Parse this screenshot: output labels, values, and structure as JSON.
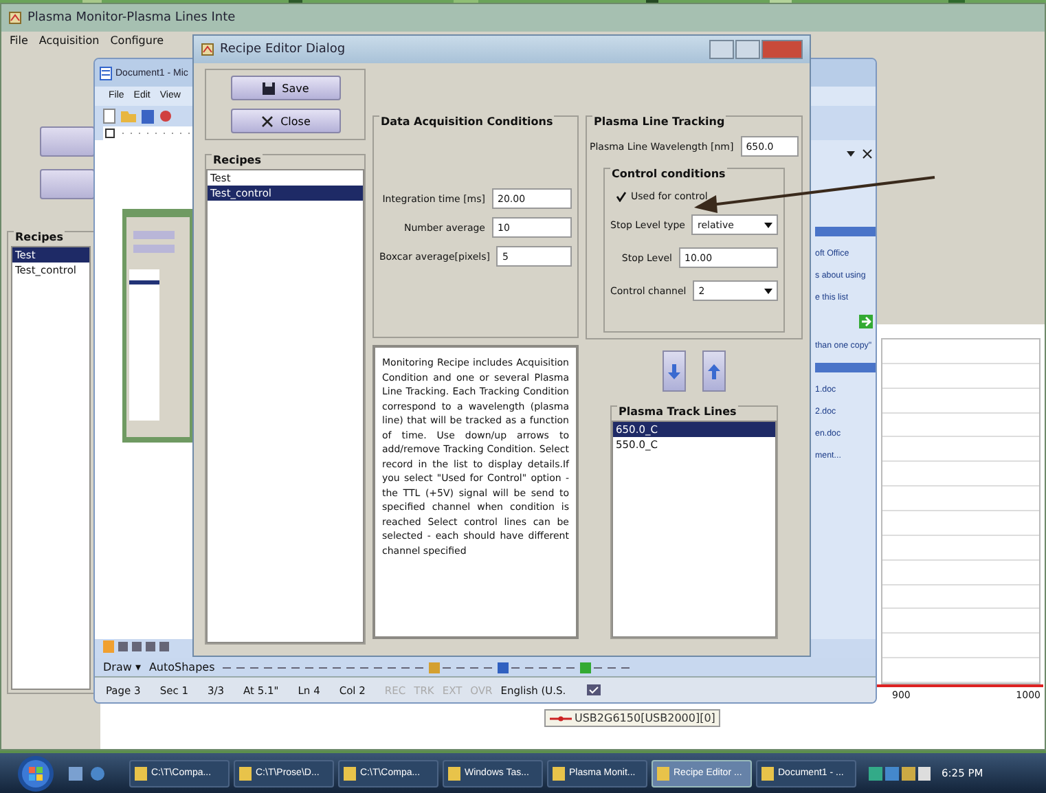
{
  "main_window": {
    "title": "Plasma Monitor-Plasma Lines Inte",
    "menu": [
      "File",
      "Acquisition",
      "Configure"
    ],
    "recipes": {
      "title": "Recipes",
      "items": [
        {
          "label": "Test",
          "selected": true
        },
        {
          "label": "Test_control",
          "selected": false
        }
      ]
    },
    "chart": {
      "tick_labels": [
        "900",
        "1000"
      ],
      "legend": "USB2G6150[USB2000][0]"
    }
  },
  "word_window": {
    "title": "Document1 - Mic",
    "menu": [
      "File",
      "Edit",
      "View"
    ],
    "task_pane_texts": [
      "oft Office",
      "s about using",
      "e this list",
      "than one copy\"",
      "1.doc",
      "2.doc",
      "en.doc",
      "ment..."
    ],
    "draw_toolbar": [
      "Draw ▾",
      "AutoShapes"
    ],
    "status_bar": [
      "Page 3",
      "Sec 1",
      "3/3",
      "At 5.1\"",
      "Ln 4",
      "Col 2"
    ],
    "status_indicators": [
      {
        "label": "REC",
        "on": false
      },
      {
        "label": "TRK",
        "on": false
      },
      {
        "label": "EXT",
        "on": false
      },
      {
        "label": "OVR",
        "on": false
      }
    ],
    "language": "English (U.S."
  },
  "dialog": {
    "title": "Recipe Editor Dialog",
    "buttons": [
      {
        "kind": "save",
        "label": "Save"
      },
      {
        "kind": "close",
        "label": "Close"
      }
    ],
    "recipes": {
      "title": "Recipes",
      "items": [
        {
          "label": "Test",
          "selected": false
        },
        {
          "label": "Test_control",
          "selected": true
        }
      ]
    },
    "acquisition": {
      "title": "Data Acquisition Conditions",
      "fields": [
        {
          "label": "Integration time [ms]",
          "value": "20.00"
        },
        {
          "label": "Number average",
          "value": "10"
        },
        {
          "label": "Boxcar average[pixels]",
          "value": "5"
        }
      ]
    },
    "description": "Monitoring Recipe includes Acquisition Condition and one or several Plasma Line Tracking. Each Tracking Condition correspond to a wavelength (plasma line) that will be tracked as a function of time. Use down/up arrows to add/remove Tracking Condition. Select record in the list to display details.If you select \"Used for Control\" option - the TTL (+5V) signal will be send to specified channel when condition is reached Select control lines can be selected - each should have different channel specified",
    "tracking": {
      "title": "Plasma Line Tracking",
      "wavelength": {
        "label": "Plasma Line Wavelength [nm]",
        "value": "650.0"
      },
      "control": {
        "title": "Control conditions",
        "used_for_control": {
          "label": "Used for control",
          "checked": true
        },
        "rows": [
          {
            "kind": "dropdown",
            "label": "Stop Level type",
            "value": "relative"
          },
          {
            "kind": "field",
            "label": "Stop Level",
            "value": "10.00"
          },
          {
            "kind": "dropdown",
            "label": "Control channel",
            "value": "2"
          }
        ]
      }
    },
    "track_lines": {
      "title": "Plasma Track Lines",
      "items": [
        {
          "label": "650.0_C",
          "selected": true
        },
        {
          "label": "550.0_C",
          "selected": false
        }
      ]
    }
  },
  "taskbar": {
    "tasks": [
      {
        "label": "C:\\T\\Compa...",
        "selected": false
      },
      {
        "label": "C:\\T\\Prose\\D...",
        "selected": false
      },
      {
        "label": "C:\\T\\Compa...",
        "selected": false
      },
      {
        "label": "Windows Tas...",
        "selected": false
      },
      {
        "label": "Plasma Monit...",
        "selected": false
      },
      {
        "label": "Recipe Editor ...",
        "selected": true
      },
      {
        "label": "Document1 - ...",
        "selected": false
      }
    ],
    "clock": "6:25 PM"
  }
}
